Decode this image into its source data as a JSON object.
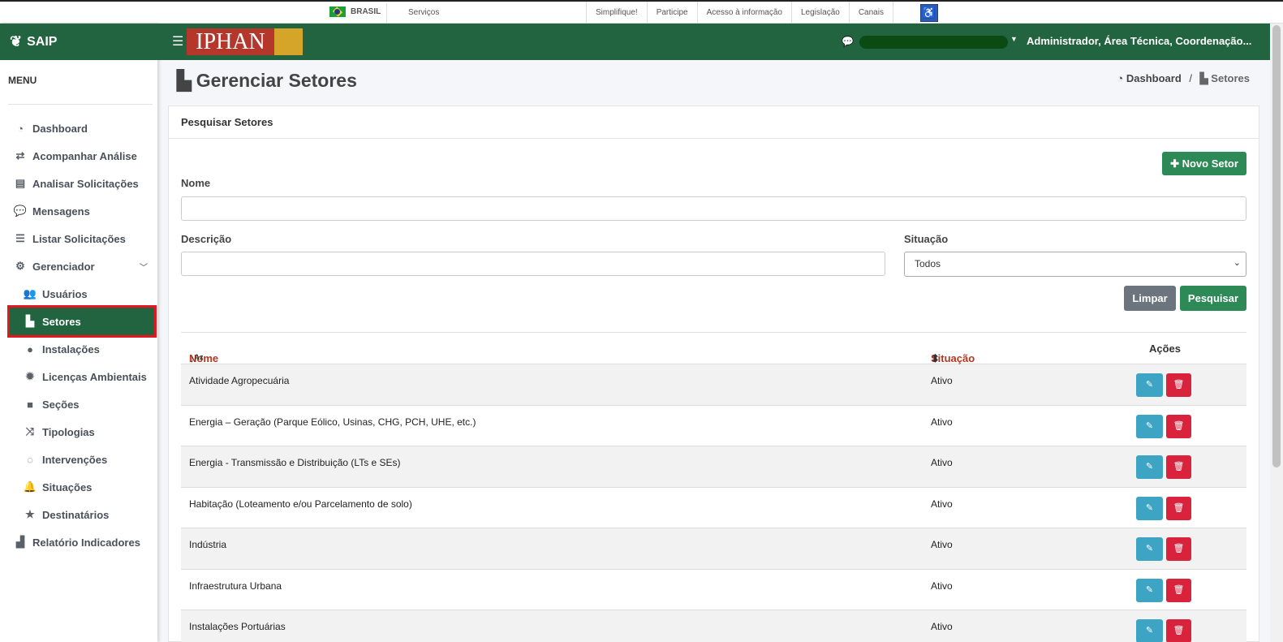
{
  "gov_bar": {
    "country": "BRASIL",
    "servicos": "Serviços",
    "links": [
      "Simplifique!",
      "Participe",
      "Acesso à informação",
      "Legislação",
      "Canais"
    ]
  },
  "sidebar": {
    "brand": "SAIP",
    "menu_title": "MENU",
    "items": [
      {
        "label": "Dashboard",
        "icon": "dashboard-icon",
        "glyph": "◔"
      },
      {
        "label": "Acompanhar Análise",
        "icon": "exchange-icon",
        "glyph": "⇄"
      },
      {
        "label": "Analisar Solicitações",
        "icon": "book-icon",
        "glyph": "▤"
      },
      {
        "label": "Mensagens",
        "icon": "comments-icon",
        "glyph": "💬"
      },
      {
        "label": "Listar Solicitações",
        "icon": "list-icon",
        "glyph": "☰"
      },
      {
        "label": "Gerenciador",
        "icon": "cogs-icon",
        "glyph": "⚙"
      },
      {
        "label": "Usuários",
        "icon": "users-icon",
        "glyph": "👥"
      },
      {
        "label": "Setores",
        "icon": "industry-icon",
        "glyph": "▙"
      },
      {
        "label": "Instalações",
        "icon": "circle-icon",
        "glyph": "●"
      },
      {
        "label": "Licenças Ambientais",
        "icon": "certificate-icon",
        "glyph": "✹"
      },
      {
        "label": "Seções",
        "icon": "square-icon",
        "glyph": "■"
      },
      {
        "label": "Tipologias",
        "icon": "random-icon",
        "glyph": "⤨"
      },
      {
        "label": "Intervenções",
        "icon": "circle-notch-icon",
        "glyph": "◌"
      },
      {
        "label": "Situações",
        "icon": "bell-icon",
        "glyph": "🔔"
      },
      {
        "label": "Destinatários",
        "icon": "star-icon",
        "glyph": "★"
      },
      {
        "label": "Relatório Indicadores",
        "icon": "area-chart-icon",
        "glyph": "▟"
      }
    ]
  },
  "header": {
    "logo_text": "IPHAN",
    "user": "Administrador, Área Técnica, Coordenação..."
  },
  "page": {
    "title": "Gerenciar Setores",
    "breadcrumb_home": "Dashboard",
    "breadcrumb_sep": "/",
    "breadcrumb_current": "Setores"
  },
  "search": {
    "card_title": "Pesquisar Setores",
    "new_button": "Novo Setor",
    "nome_label": "Nome",
    "nome_value": "",
    "descricao_label": "Descrição",
    "descricao_value": "",
    "situacao_label": "Situação",
    "situacao_selected": "Todos",
    "clear_button": "Limpar",
    "search_button": "Pesquisar"
  },
  "table": {
    "headers": {
      "nome": "Nome",
      "situacao": "Situação",
      "acoes": "Ações"
    },
    "rows": [
      {
        "nome": "Atividade Agropecuária",
        "situacao": "Ativo"
      },
      {
        "nome": "Energia – Geração (Parque Eólico, Usinas, CHG, PCH, UHE, etc.)",
        "situacao": "Ativo"
      },
      {
        "nome": "Energia - Transmissão e Distribuição (LTs e SEs)",
        "situacao": "Ativo"
      },
      {
        "nome": "Habitação (Loteamento e/ou Parcelamento de solo)",
        "situacao": "Ativo"
      },
      {
        "nome": "Indústria",
        "situacao": "Ativo"
      },
      {
        "nome": "Infraestrutura Urbana",
        "situacao": "Ativo"
      },
      {
        "nome": "Instalações Portuárias",
        "situacao": "Ativo"
      }
    ]
  },
  "colors": {
    "brand_green": "#21643f",
    "button_green": "#2d8a56",
    "edit_blue": "#3ea4c4",
    "delete_red": "#d9233d",
    "highlight_red": "#e8141e"
  }
}
